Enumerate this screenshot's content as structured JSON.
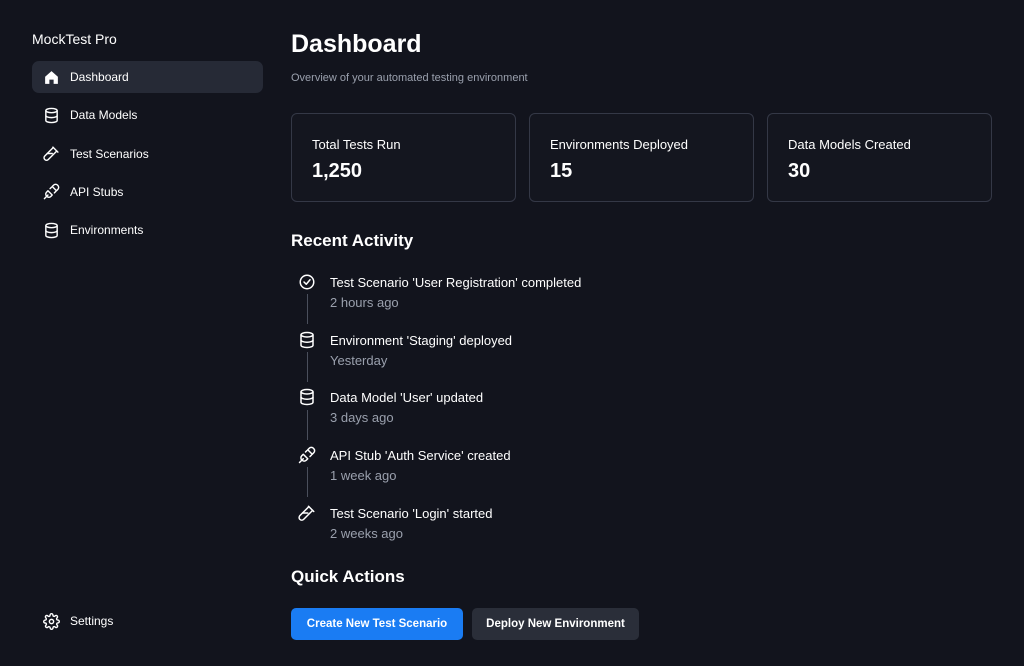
{
  "app": {
    "title": "MockTest Pro"
  },
  "sidebar": {
    "items": [
      {
        "label": "Dashboard",
        "icon": "home-icon",
        "active": true
      },
      {
        "label": "Data Models",
        "icon": "database-icon",
        "active": false
      },
      {
        "label": "Test Scenarios",
        "icon": "test-tube-icon",
        "active": false
      },
      {
        "label": "API Stubs",
        "icon": "plug-icon",
        "active": false
      },
      {
        "label": "Environments",
        "icon": "database-icon",
        "active": false
      }
    ],
    "settings": {
      "label": "Settings",
      "icon": "gear-icon"
    }
  },
  "header": {
    "title": "Dashboard",
    "subtitle": "Overview of your automated testing environment"
  },
  "stats": [
    {
      "label": "Total Tests Run",
      "value": "1,250"
    },
    {
      "label": "Environments Deployed",
      "value": "15"
    },
    {
      "label": "Data Models Created",
      "value": "30"
    }
  ],
  "recent_activity": {
    "title": "Recent Activity",
    "items": [
      {
        "text": "Test Scenario 'User Registration' completed",
        "time": "2 hours ago",
        "icon": "check-circle-icon"
      },
      {
        "text": "Environment 'Staging' deployed",
        "time": "Yesterday",
        "icon": "database-icon"
      },
      {
        "text": "Data Model 'User' updated",
        "time": "3 days ago",
        "icon": "database-icon"
      },
      {
        "text": "API Stub 'Auth Service' created",
        "time": "1 week ago",
        "icon": "plug-icon"
      },
      {
        "text": "Test Scenario 'Login' started",
        "time": "2 weeks ago",
        "icon": "test-tube-icon"
      }
    ]
  },
  "quick_actions": {
    "title": "Quick Actions",
    "primary_label": "Create New Test Scenario",
    "secondary_label": "Deploy New Environment"
  },
  "colors": {
    "background": "#12141d",
    "accent": "#1a7cf3",
    "active_nav": "#262a36",
    "muted_text": "#9aa0ad",
    "card_border": "#343846"
  }
}
